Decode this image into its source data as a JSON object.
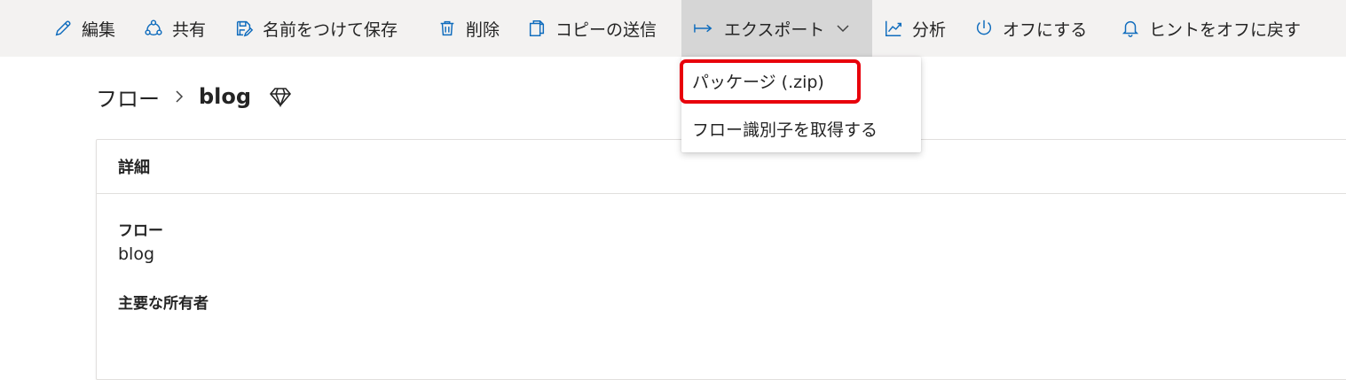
{
  "toolbar": {
    "edit": "編集",
    "share": "共有",
    "save_as": "名前をつけて保存",
    "delete": "削除",
    "send_copy": "コピーの送信",
    "export": "エクスポート",
    "analytics": "分析",
    "turn_off": "オフにする",
    "hints": "ヒントをオフに戻す"
  },
  "export_menu": {
    "items": [
      {
        "label": "パッケージ (.zip)"
      },
      {
        "label": "フロー識別子を取得する"
      }
    ]
  },
  "breadcrumb": {
    "root": "フロー",
    "current": "blog"
  },
  "details": {
    "header": "詳細",
    "flow_label": "フロー",
    "flow_value": "blog",
    "owner_label": "主要な所有者"
  },
  "colors": {
    "accent": "#0f6cbd",
    "toolbar_bg": "#f3f2f1",
    "active_bg": "#d6d6d6",
    "highlight": "#e8000b"
  }
}
